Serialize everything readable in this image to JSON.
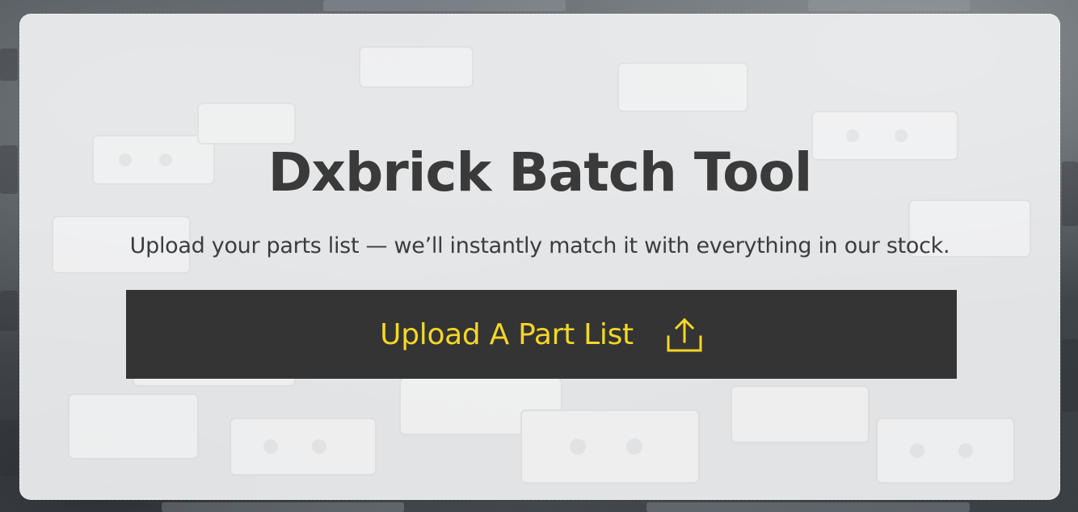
{
  "card": {
    "title": "Dxbrick Batch Tool",
    "subtitle": "Upload your parts list — we’ll instantly match it with everything in our stock."
  },
  "upload": {
    "label": "Upload A Part List",
    "icon": "upload-icon"
  },
  "colors": {
    "button_bg": "#343434",
    "button_text": "#f5d726",
    "title_text": "#3a3a3a"
  }
}
